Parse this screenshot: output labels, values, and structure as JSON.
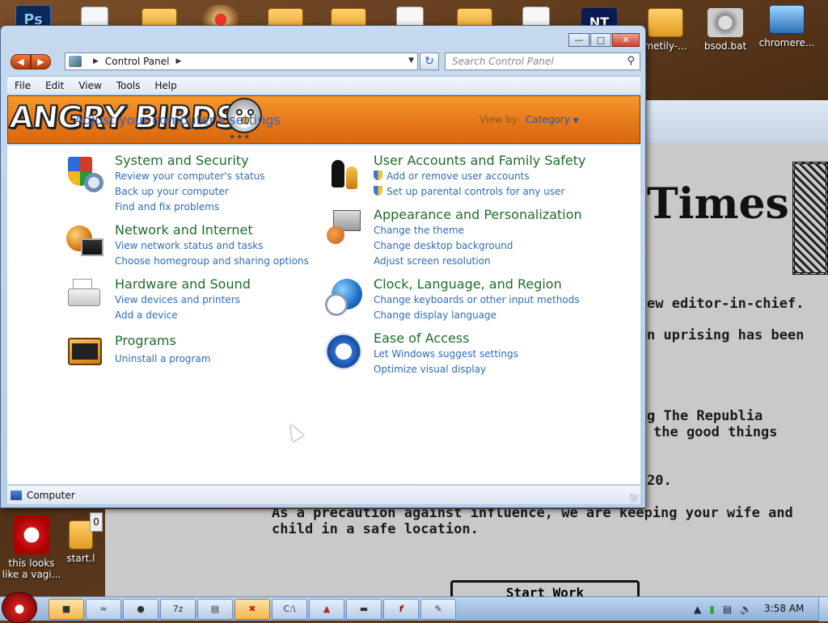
{
  "desktop": {
    "top_icons": [
      {
        "name": "ps-icon",
        "label": ""
      },
      {
        "name": "folder-icon",
        "label": ""
      },
      {
        "name": "document-icon",
        "label": ""
      },
      {
        "name": "folder-icon",
        "label": ""
      },
      {
        "name": "hat-icon",
        "label": ""
      },
      {
        "name": "folder-icon",
        "label": ""
      },
      {
        "name": "folder-icon",
        "label": ""
      },
      {
        "name": "document-icon",
        "label": ""
      },
      {
        "name": "folder-icon",
        "label": ""
      },
      {
        "name": "document-icon",
        "label": ""
      },
      {
        "name": "nt-icon",
        "label": ""
      },
      {
        "name": "folder-icon",
        "label": "metily-..."
      },
      {
        "name": "gear-icon",
        "label": "bsod.bat"
      },
      {
        "name": "installer-icon",
        "label": "chromere..."
      }
    ],
    "left_icons": [
      {
        "label": "this looks like a vagi..."
      },
      {
        "label": "start.l"
      }
    ],
    "small_box_value": "0"
  },
  "background_window": {
    "masthead": "Times",
    "lines": [
      "ew editor-in-chief.",
      "n uprising has been",
      "g The Republia",
      "the good things",
      "20.",
      "As a precaution against influence, we are keeping your wife and",
      "child in a safe location."
    ],
    "start_button": "Start Work"
  },
  "window": {
    "address": {
      "segments": [
        "Control Panel"
      ]
    },
    "search_placeholder": "Search Control Panel",
    "menu": [
      "File",
      "Edit",
      "View",
      "Tools",
      "Help"
    ],
    "banner": {
      "logo_text": "ANGRY BIRDS",
      "title": "Adjust your computer's settings",
      "view_by_label": "View by:",
      "view_by_value": "Category"
    },
    "categories": [
      {
        "title": "System and Security",
        "links": [
          "Review your computer's status",
          "Back up your computer",
          "Find and fix problems"
        ]
      },
      {
        "title": "Network and Internet",
        "links": [
          "View network status and tasks",
          "Choose homegroup and sharing options"
        ]
      },
      {
        "title": "Hardware and Sound",
        "links": [
          "View devices and printers",
          "Add a device"
        ]
      },
      {
        "title": "Programs",
        "links": [
          "Uninstall a program"
        ]
      },
      {
        "title": "User Accounts and Family Safety",
        "links": [
          "Add or remove user accounts",
          "Set up parental controls for any user"
        ]
      },
      {
        "title": "Appearance and Personalization",
        "links": [
          "Change the theme",
          "Change desktop background",
          "Adjust screen resolution"
        ]
      },
      {
        "title": "Clock, Language, and Region",
        "links": [
          "Change keyboards or other input methods",
          "Change display language"
        ]
      },
      {
        "title": "Ease of Access",
        "links": [
          "Let Windows suggest settings",
          "Optimize visual display"
        ]
      }
    ],
    "status_text": "Computer"
  },
  "taskbar": {
    "items": [
      {
        "name": "explorer-taskbar-button"
      },
      {
        "name": "task-manager-taskbar-button"
      },
      {
        "name": "network-taskbar-button"
      },
      {
        "name": "sevenzip-taskbar-button",
        "label": "7z"
      },
      {
        "name": "notepad-taskbar-button"
      },
      {
        "name": "close-app-taskbar-button"
      },
      {
        "name": "cmd-taskbar-button",
        "label": "C:\\"
      },
      {
        "name": "app-taskbar-button"
      },
      {
        "name": "drive-taskbar-button"
      },
      {
        "name": "flash-taskbar-button",
        "label": "f"
      },
      {
        "name": "paint-taskbar-button"
      }
    ],
    "clock": "3:58 AM"
  },
  "colors": {
    "banner_orange": "#e5781a",
    "category_title_green": "#1f6b2b",
    "link_blue": "#2e6bb8"
  }
}
